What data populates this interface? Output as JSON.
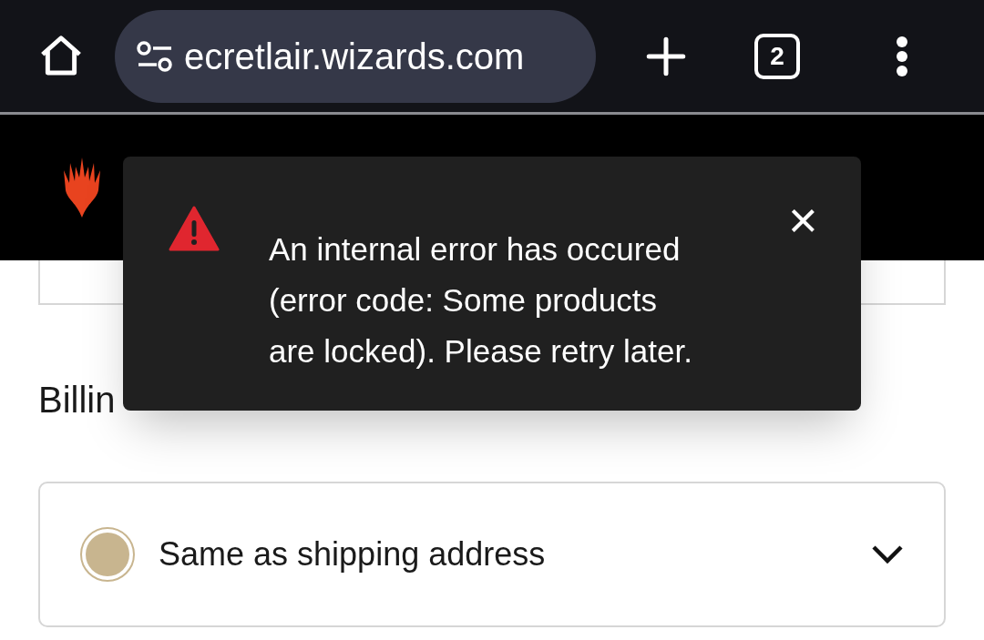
{
  "browser": {
    "url": "ecretlair.wizards.com",
    "tab_count": "2"
  },
  "toast": {
    "message": "An internal error has occured (error code: Some products are locked). Please retry later.",
    "close": "×"
  },
  "billing": {
    "heading": "Billin",
    "options": [
      {
        "label": "Same as shipping address",
        "selected": true
      }
    ]
  }
}
